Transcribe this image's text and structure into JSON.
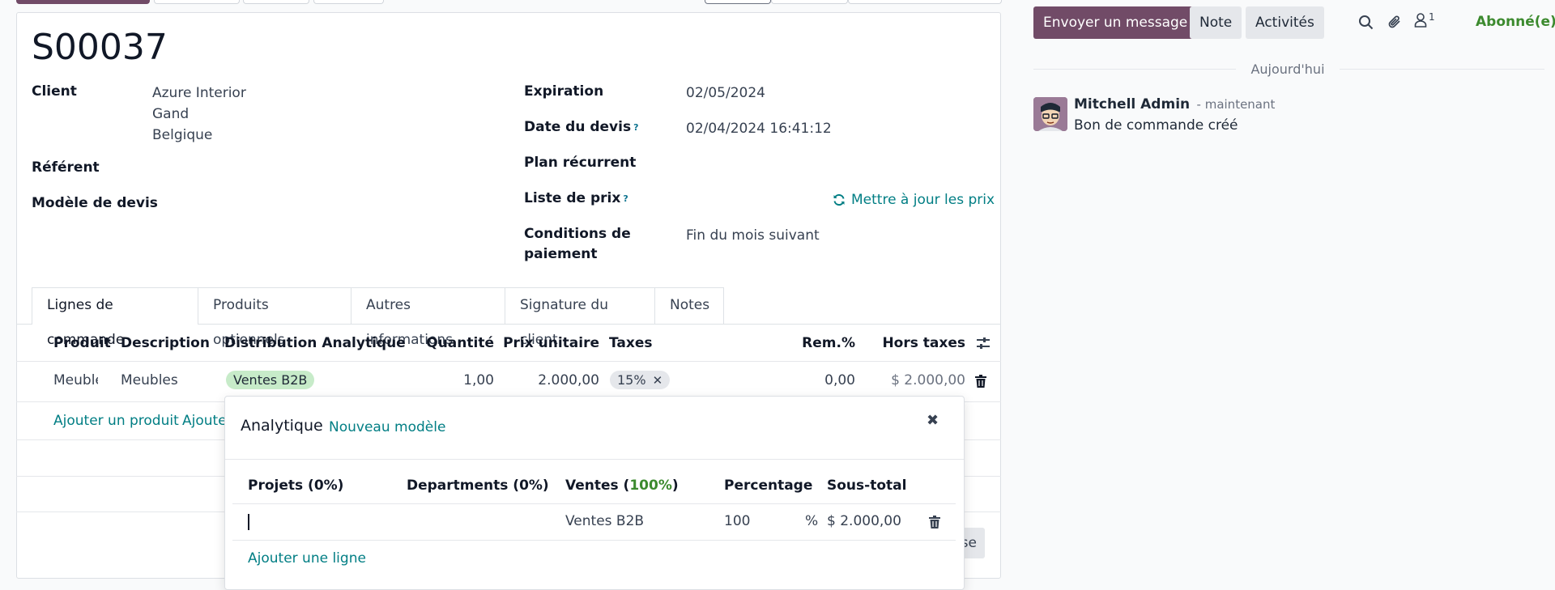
{
  "record": {
    "name": "S00037"
  },
  "fields": {
    "client_label": "Client",
    "client_lines": [
      "Azure Interior",
      "Gand",
      "Belgique"
    ],
    "referent_label": "Référent",
    "template_label": "Modèle de devis",
    "expiration_label": "Expiration",
    "expiration_value": "02/05/2024",
    "quote_date_label": "Date du devis",
    "quote_date_value": "02/04/2024 16:41:12",
    "recurring_label": "Plan récurrent",
    "pricelist_label": "Liste de prix",
    "update_prices_label": "Mettre à jour les prix",
    "payment_terms_label_1": "Conditions de",
    "payment_terms_label_2": "paiement",
    "payment_terms_value": "Fin du mois suivant",
    "help_mark": "?"
  },
  "tabs": [
    "Lignes de commande",
    "Produits optionnels",
    "Autres informations",
    "Signature du client",
    "Notes"
  ],
  "order_table": {
    "headers": [
      "Produit",
      "Description",
      "Distribution Analytique",
      "Quantité",
      "Prix unitaire",
      "Taxes",
      "Rem.%",
      "Hors taxes"
    ],
    "row": {
      "product": "Meuble",
      "description": "Meubles",
      "analytic": "Ventes B2B",
      "quantity": "1,00",
      "unit_price": "2.000,00",
      "tax": "15%",
      "discount": "0,00",
      "subtotal": "$ 2.000,00"
    },
    "add_product": "Ajouter un produit",
    "add_section": "Ajouter",
    "hidden_button_fragment": "se"
  },
  "analytic_popover": {
    "title": "Analytique",
    "new_model": "Nouveau modèle",
    "close_glyph": "✖",
    "col_projects": "Projets (0%)",
    "col_departments": "Departments (0%)",
    "col_sales_prefix": "Ventes (",
    "col_sales_pct": "100%",
    "col_sales_suffix": ")",
    "col_percentage": "Percentage",
    "col_subtotal": "Sous-total",
    "row_sales": "Ventes B2B",
    "row_percentage": "100",
    "row_percent_sign": "%",
    "row_subtotal": "$ 2.000,00",
    "add_line": "Ajouter une ligne"
  },
  "chatter": {
    "send_message": "Envoyer un message",
    "note": "Note",
    "activities": "Activités",
    "follower_count": "1",
    "follow_status": "Abonné(e)",
    "date_separator": "Aujourd'hui",
    "author": "Mitchell Admin",
    "time": "- maintenant",
    "message": "Bon de commande créé"
  },
  "colors": {
    "primary": "#714b67",
    "link": "#017e84",
    "success": "#3c8a2e",
    "tag_green_bg": "#c7ebc9",
    "tag_tax_bg": "#e5e7eb"
  }
}
